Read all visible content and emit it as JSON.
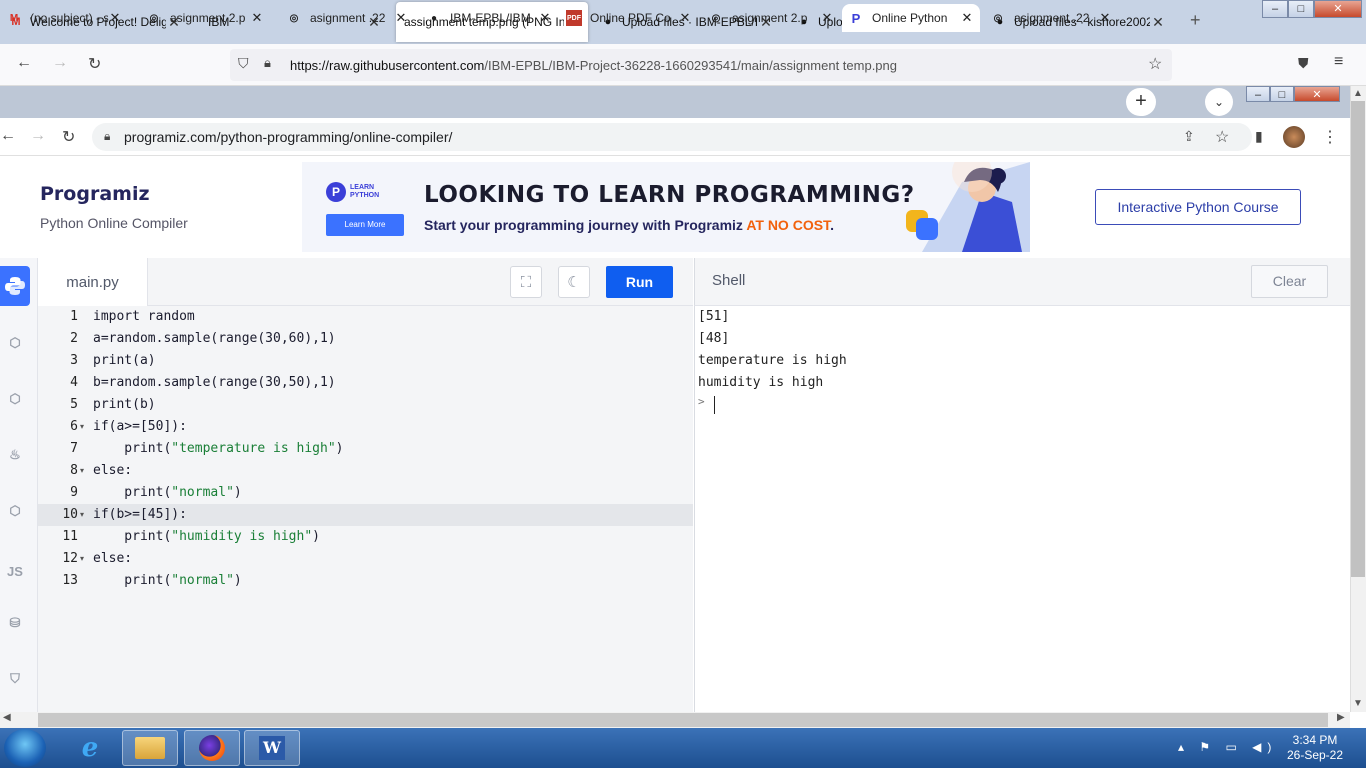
{
  "firefox": {
    "tabs": [
      {
        "label": "Welcome to Project! Delig",
        "icon": "gmail-icon"
      },
      {
        "label": "IBM",
        "icon": "none"
      },
      {
        "label": "assignment temp.png (PNG In",
        "icon": "none",
        "active": true
      },
      {
        "label": "Upload files · IBM-EPBL/IBI",
        "icon": "github-icon"
      },
      {
        "label": "Upload files · IBM-EPBL/IBI",
        "icon": "github-icon"
      },
      {
        "label": "Upload files · kishore20021",
        "icon": "github-icon"
      }
    ],
    "url_host": "https://raw.githubusercontent.com",
    "url_path": "/IBM-EPBL/IBM-Project-36228-1660293541/main/assignment temp.png"
  },
  "chrome": {
    "tabs": [
      {
        "label": "(no subject) - s",
        "icon": "gmail-icon"
      },
      {
        "label": "asignment 2.p",
        "icon": "globe-icon"
      },
      {
        "label": "asignment .22",
        "icon": "globe-icon"
      },
      {
        "label": "IBM-EPBL/IBM",
        "icon": "github-icon"
      },
      {
        "label": "Online PDF Co",
        "icon": "pdf-icon"
      },
      {
        "label": "asignment 2.p",
        "icon": "globe-icon"
      },
      {
        "label": "Online Python",
        "icon": "programiz-icon",
        "active": true
      },
      {
        "label": "asignment .22",
        "icon": "globe-icon"
      }
    ],
    "url_host": "programiz.com",
    "url_path": "/python-programming/online-compiler/"
  },
  "header": {
    "logo": "Programiz",
    "subtitle": "Python Online Compiler",
    "course_button": "Interactive Python Course"
  },
  "banner": {
    "badge_line1": "LEARN",
    "badge_line2": "PYTHON",
    "learn_more": "Learn More",
    "headline": "LOOKING TO LEARN PROGRAMMING?",
    "sub_prefix": "Start your programming journey with Programiz ",
    "sub_highlight": "AT NO COST",
    "sub_suffix": "."
  },
  "rail": {
    "items": [
      "python-icon",
      "c-icon",
      "cpp-icon",
      "java-icon",
      "csharp-icon",
      "JS",
      "database-icon",
      "html5-icon"
    ]
  },
  "editor": {
    "file_tab": "main.py",
    "run_label": "Run",
    "lines": [
      {
        "n": "1",
        "code": "import random"
      },
      {
        "n": "2",
        "code": "a=random.sample(range(30,60),1)"
      },
      {
        "n": "3",
        "code": "print(a)"
      },
      {
        "n": "4",
        "code": "b=random.sample(range(30,50),1)"
      },
      {
        "n": "5",
        "code": "print(b)"
      },
      {
        "n": "6",
        "code": "if(a>=[50]):"
      },
      {
        "n": "7",
        "code": "    print(\"temperature is high\")"
      },
      {
        "n": "8",
        "code": "else:"
      },
      {
        "n": "9",
        "code": "    print(\"normal\")"
      },
      {
        "n": "10",
        "code": "if(b>=[45]):"
      },
      {
        "n": "11",
        "code": "    print(\"humidity is high\")"
      },
      {
        "n": "12",
        "code": "else:"
      },
      {
        "n": "13",
        "code": "    print(\"normal\")"
      }
    ]
  },
  "shell": {
    "title": "Shell",
    "clear_label": "Clear",
    "output": [
      "[51]",
      "[48]",
      "temperature is high",
      "humidity is high"
    ],
    "prompt": ">"
  },
  "taskbar": {
    "time": "3:34 PM",
    "date": "26-Sep-22"
  }
}
